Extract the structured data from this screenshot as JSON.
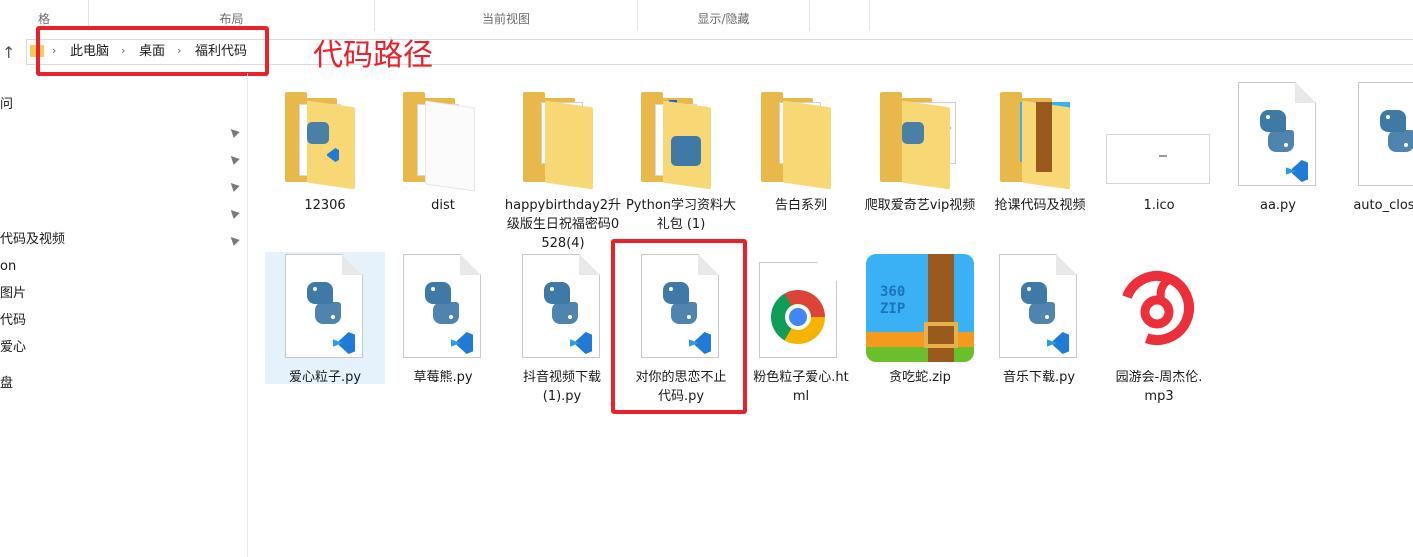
{
  "ribbon": {
    "groups": [
      "格",
      "布局",
      "当前视图",
      "显示/隐藏"
    ]
  },
  "address": {
    "crumbs": [
      "此电脑",
      "桌面",
      "福利代码"
    ],
    "annotation": "代码路径"
  },
  "sidebar": {
    "items": [
      "问",
      "",
      "",
      "",
      "",
      "代码及视频",
      "on",
      "图片",
      "代码",
      "爱心",
      "",
      "盘"
    ]
  },
  "files": {
    "row1": [
      {
        "name": "12306",
        "type": "folder"
      },
      {
        "name": "dist",
        "type": "folder"
      },
      {
        "name": "happybirthday2升级版生日祝福密码0528(4)",
        "type": "folder"
      },
      {
        "name": "Python学习资料大礼包 (1)",
        "type": "folder"
      },
      {
        "name": "告白系列",
        "type": "folder"
      },
      {
        "name": "爬取爱奇艺vip视频",
        "type": "folder"
      },
      {
        "name": "抢课代码及视频",
        "type": "folder"
      },
      {
        "name": "1.ico",
        "type": "ico"
      },
      {
        "name": "aa.py",
        "type": "py"
      },
      {
        "name": "auto_close.py",
        "type": "py"
      }
    ],
    "row2": [
      {
        "name": "爱心粒子.py",
        "type": "py"
      },
      {
        "name": "草莓熊.py",
        "type": "py"
      },
      {
        "name": "抖音视频下载(1).py",
        "type": "py"
      },
      {
        "name": "对你的思恋不止代码.py",
        "type": "py"
      },
      {
        "name": "粉色粒子爱心.html",
        "type": "html"
      },
      {
        "name": "贪吃蛇.zip",
        "type": "zip"
      },
      {
        "name": "音乐下载.py",
        "type": "py"
      },
      {
        "name": "园游会-周杰伦.mp3",
        "type": "mp3"
      }
    ]
  },
  "zip_badge": {
    "line1": "360",
    "line2": "ZIP"
  },
  "colors": {
    "highlight_red": "#e8212b",
    "selection": "#e5f1fb",
    "folder_yellow": "#f8d775",
    "python_blue": "#3f7aa6",
    "vscode_blue": "#1f7bd6"
  },
  "icons": {
    "up": "up-arrow-icon",
    "pin": "pin-icon",
    "crumb_sep": "chevron-right-icon"
  }
}
